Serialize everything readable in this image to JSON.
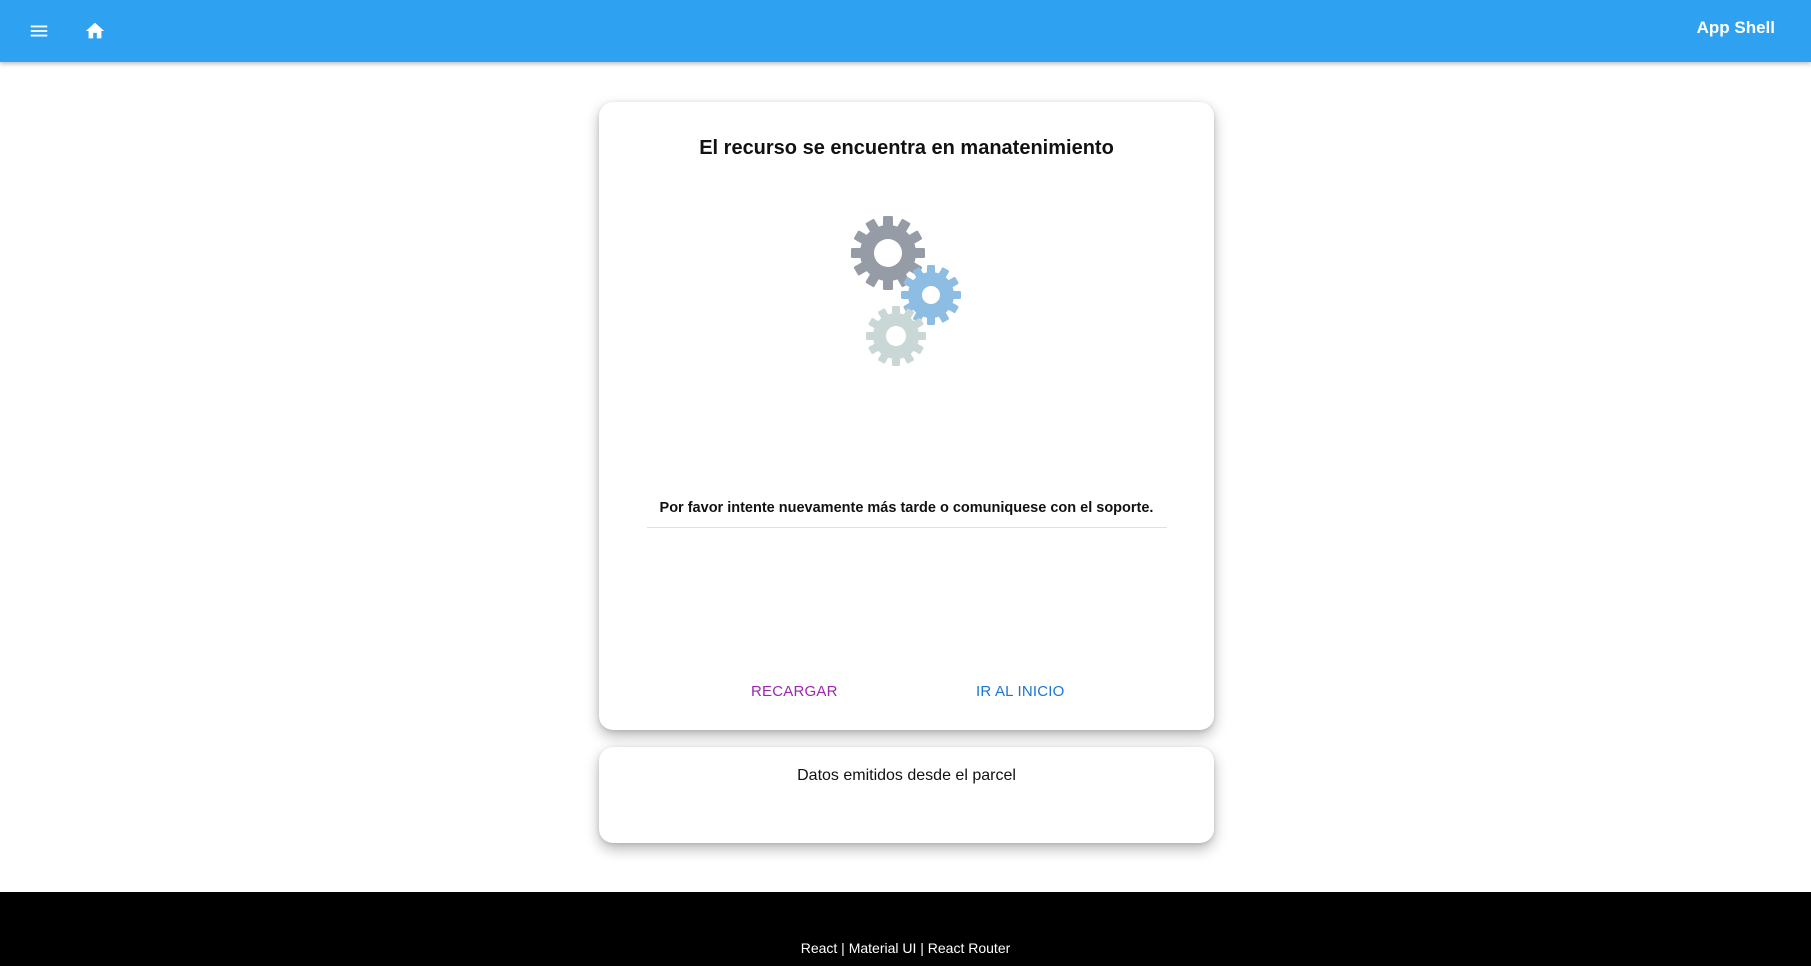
{
  "header": {
    "menu_icon": "menu-icon",
    "home_icon": "home-icon",
    "title": "App Shell",
    "color": "#2ea2f0"
  },
  "main_card": {
    "title": "El recurso se encuentra en manatenimiento",
    "illustration": "gears-icon",
    "message": "Por favor intente nuevamente más tarde o comuniquese con el soporte.",
    "reload_label": "RECARGAR",
    "home_label": "IR AL INICIO",
    "reload_color": "#9c27b0",
    "home_color": "#1976d2"
  },
  "parcel_card": {
    "text": "Datos emitidos desde el parcel"
  },
  "footer": {
    "text": "React | Material UI | React Router"
  }
}
